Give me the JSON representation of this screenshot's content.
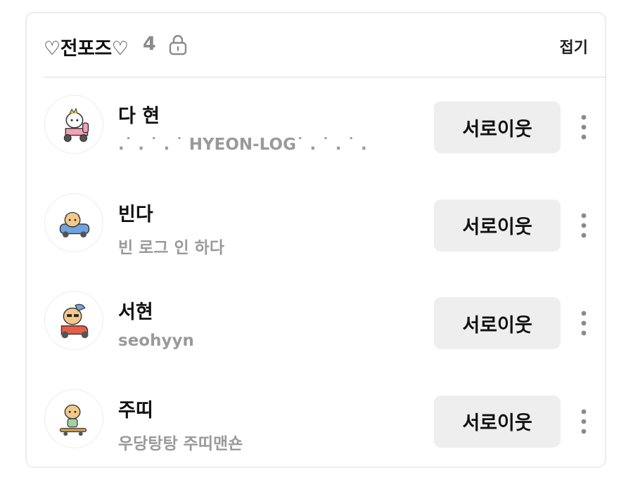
{
  "group": {
    "title": "♡전포즈♡",
    "count": "4",
    "lock_icon": "lock-icon",
    "collapse_label": "접기"
  },
  "neighbors": [
    {
      "name": "다 현",
      "description": ".˙ . ˙ . ˙ HYEON-LOG˙ . ˙ . ˙ .",
      "button_label": "서로이웃",
      "avatar_icon": "character-pink-scooter-avatar"
    },
    {
      "name": "빈다",
      "description": "빈 로그 인 하다",
      "button_label": "서로이웃",
      "avatar_icon": "character-blue-car-avatar"
    },
    {
      "name": "서현",
      "description": "seohyyn",
      "button_label": "서로이웃",
      "avatar_icon": "character-red-scooter-avatar"
    },
    {
      "name": "주띠",
      "description": "우당탕탕 주띠맨숀",
      "button_label": "서로이웃",
      "avatar_icon": "character-skateboard-avatar"
    }
  ],
  "colors": {
    "button_bg": "#eeeeee",
    "muted_text": "#9a9a9a",
    "divider": "#ececec"
  }
}
